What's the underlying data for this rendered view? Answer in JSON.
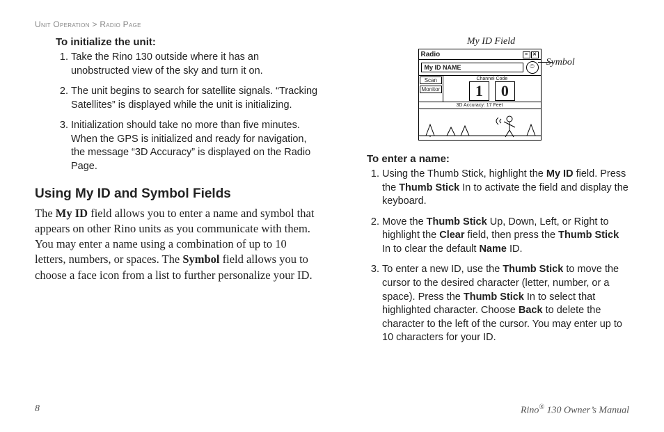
{
  "breadcrumb": {
    "a": "Unit Operation",
    "sep": " > ",
    "b": "Radio Page"
  },
  "left": {
    "init_title": "To initialize the unit:",
    "init_steps": [
      "Take the Rino 130 outside where it has an unobstructed view of the sky and turn it on.",
      "The unit begins to search for satellite signals. “Tracking Satellites” is displayed while the unit is initializing.",
      "Initialization should take no more than five minutes. When the GPS is initialized and ready for navigation, the message “3D Accuracy” is displayed on the Radio Page."
    ],
    "section_heading": "Using My ID and Symbol Fields",
    "para": {
      "pre": "The ",
      "b1": "My ID",
      "mid1": " field allows you to enter a name and symbol that appears on other Rino units as you communicate with them. You may enter a name using a combination of up to 10 letters, numbers, or spaces. The ",
      "b2": "Symbol",
      "mid2": " field allows you to choose a face icon from a list to further personalize your ID."
    }
  },
  "figure": {
    "top_label": "My ID Field",
    "side_label": "Symbol",
    "screen": {
      "title": "Radio",
      "id_field": "My ID NAME",
      "btn_scan": "Scan",
      "btn_monitor": "Monitor",
      "ch_label": "Channel   Code",
      "ch": "1",
      "code": "0",
      "status": "3D Accuracy: 17 Feet"
    }
  },
  "right": {
    "enter_title": "To enter a name:",
    "steps": [
      {
        "pre": "Using the Thumb Stick, highlight the ",
        "b1": "My ID",
        "mid1": " field. Press the ",
        "b2": "Thumb Stick",
        "post": " In to activate the field and display the keyboard."
      },
      {
        "pre": "Move the ",
        "b1": "Thumb Stick",
        "mid1": " Up, Down, Left, or Right to highlight the ",
        "b2": "Clear",
        "mid2": " field, then press the ",
        "b3": "Thumb Stick",
        "mid3": " In to clear the default ",
        "b4": "Name",
        "post": " ID."
      },
      {
        "pre": "To enter a new ID, use the ",
        "b1": "Thumb Stick",
        "mid1": " to move the cursor to the desired character (letter, number, or a space). Press the ",
        "b2": "Thumb Stick",
        "mid2": " In to select that highlighted character. Choose ",
        "b3": "Back",
        "post": " to delete the character to the left of the cursor. You may enter up to 10 characters for your ID."
      }
    ]
  },
  "footer": {
    "page": "8",
    "brand": "Rino",
    "model": " 130 Owner’s Manual",
    "reg": "®"
  }
}
